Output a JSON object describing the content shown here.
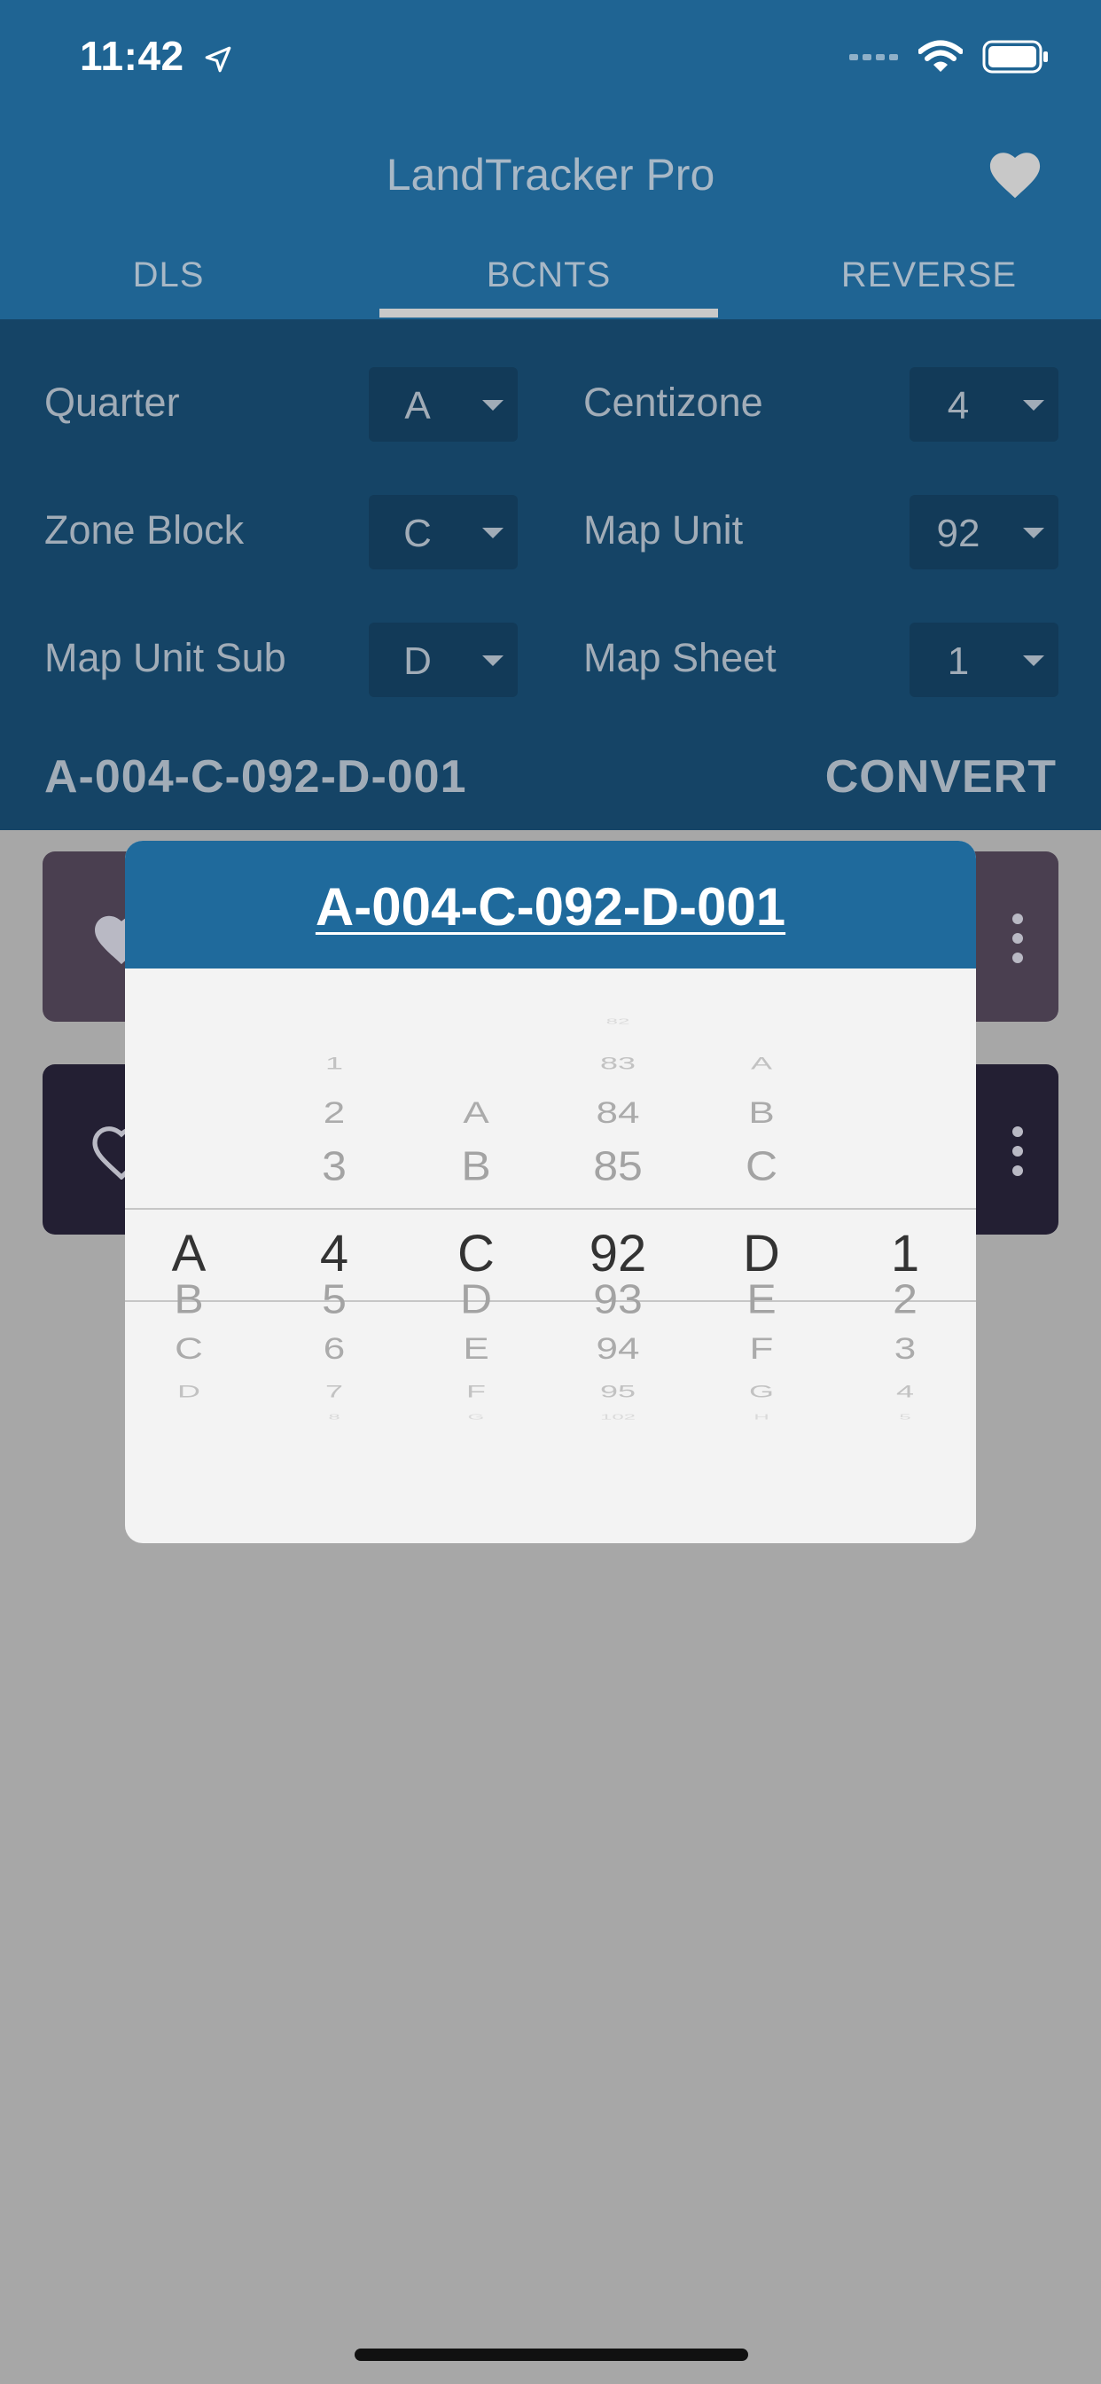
{
  "status_bar": {
    "time": "11:42"
  },
  "header": {
    "title": "LandTracker Pro",
    "tabs": [
      {
        "label": "DLS",
        "active": false
      },
      {
        "label": "BCNTS",
        "active": true
      },
      {
        "label": "REVERSE",
        "active": false
      }
    ]
  },
  "form": {
    "fields": [
      {
        "label": "Quarter",
        "value": "A"
      },
      {
        "label": "Centizone",
        "value": "4"
      },
      {
        "label": "Zone Block",
        "value": "C"
      },
      {
        "label": "Map Unit",
        "value": "92"
      },
      {
        "label": "Map Unit Sub",
        "value": "D"
      },
      {
        "label": "Map Sheet",
        "value": "1"
      }
    ],
    "result": "A-004-C-092-D-001",
    "convert_label": "CONVERT"
  },
  "modal": {
    "title": "A-004-C-092-D-001",
    "columns": [
      {
        "name": "quarter",
        "items": [
          "",
          "",
          "",
          "",
          "A",
          "B",
          "C",
          "D",
          ""
        ]
      },
      {
        "name": "centizone",
        "items": [
          "",
          "1",
          "2",
          "3",
          "4",
          "5",
          "6",
          "7",
          "8"
        ]
      },
      {
        "name": "zone-block",
        "items": [
          "",
          "",
          "A",
          "B",
          "C",
          "D",
          "E",
          "F",
          "G"
        ]
      },
      {
        "name": "map-unit",
        "items": [
          "82",
          "83",
          "84",
          "85",
          "92",
          "93",
          "94",
          "95",
          "102"
        ]
      },
      {
        "name": "map-unit-sub",
        "items": [
          "",
          "A",
          "B",
          "C",
          "D",
          "E",
          "F",
          "G",
          "H"
        ]
      },
      {
        "name": "map-sheet",
        "items": [
          "",
          "",
          "",
          "",
          "1",
          "2",
          "3",
          "4",
          "5"
        ]
      }
    ]
  },
  "colors": {
    "header_bg": "#1f6493",
    "panel_bg": "#154466",
    "modal_header_bg": "#1f6a9c",
    "overlay_bg": "#a7a7a7"
  }
}
